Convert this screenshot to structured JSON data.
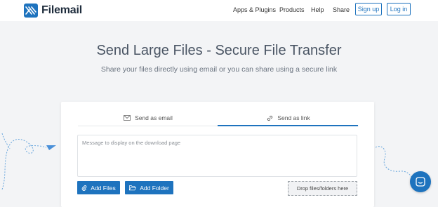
{
  "header": {
    "brand": "Filemail",
    "nav": [
      {
        "label": "Apps & Plugins"
      },
      {
        "label": "Products"
      },
      {
        "label": "Help"
      },
      {
        "label": "Share"
      }
    ],
    "signup_label": "Sign up",
    "login_label": "Log in"
  },
  "hero": {
    "title": "Send Large Files - Secure File Transfer",
    "subtitle": "Share your files directly using email or you can share using a secure link"
  },
  "transfer": {
    "tabs": [
      {
        "label": "Send as email",
        "icon": "mail-icon",
        "active": false
      },
      {
        "label": "Send as link",
        "icon": "link-icon",
        "active": true
      }
    ],
    "message_placeholder": "Message to display on the download page",
    "add_files_label": "Add Files",
    "add_folder_label": "Add Folder",
    "drop_label": "Drop files/folders here"
  },
  "colors": {
    "accent": "#1e73be",
    "background": "#f3f4f6"
  }
}
